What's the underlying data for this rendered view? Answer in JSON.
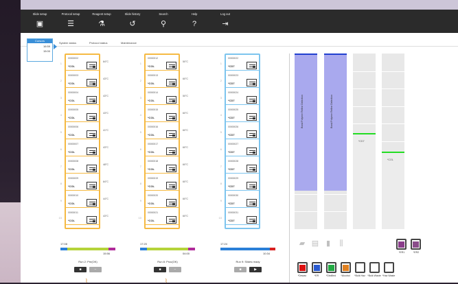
{
  "menu": [
    {
      "label": "Slide setup",
      "icon": "slide-setup-icon",
      "glyph": "▣"
    },
    {
      "label": "Protocol setup",
      "icon": "protocol-setup-icon",
      "glyph": "☰"
    },
    {
      "label": "Reagent setup",
      "icon": "reagent-setup-icon",
      "glyph": "⚗"
    },
    {
      "label": "Slide history",
      "icon": "slide-history-icon",
      "glyph": "↺"
    },
    {
      "label": "Search",
      "icon": "search-icon",
      "glyph": "⚲"
    },
    {
      "label": "Help",
      "icon": "help-icon",
      "glyph": "?"
    },
    {
      "label": "Log out",
      "icon": "logout-icon",
      "glyph": "⇥"
    }
  ],
  "tabs": [
    "System status",
    "Protocol status",
    "Maintenance"
  ],
  "timebox": {
    "header": "Cursors",
    "times": [
      "16:59",
      "15:00"
    ]
  },
  "baths": [
    {
      "color": "#f5b942",
      "slots": [
        {
          "n": "1",
          "code": "00000002",
          "sub": "*COL",
          "temp": "84°C"
        },
        {
          "n": "2",
          "code": "00000003",
          "sub": "*COL",
          "temp": "43°C"
        },
        {
          "n": "3",
          "code": "00000004",
          "sub": "*COL",
          "temp": "43°C"
        },
        {
          "n": "4",
          "code": "00000005",
          "sub": "*COL",
          "temp": "43°C"
        },
        {
          "n": "5",
          "code": "00000006",
          "sub": "*COL",
          "temp": "41°C"
        },
        {
          "n": "6",
          "code": "00000007",
          "sub": "*COL",
          "temp": "43°C"
        },
        {
          "n": "7",
          "code": "00000008",
          "sub": "*COL",
          "temp": "48°C"
        },
        {
          "n": "8",
          "code": "00000009",
          "sub": "*COL",
          "temp": "84°C"
        },
        {
          "n": "9",
          "code": "00000010",
          "sub": "*COL",
          "temp": "44°C"
        },
        {
          "n": "10",
          "code": "00000011",
          "sub": "*COL",
          "temp": "43°C"
        }
      ],
      "run": {
        "start": "17:08",
        "end": "15:56",
        "label": "Run 2: Pre(OK)"
      }
    },
    {
      "color": "#f5b942",
      "slots": [
        {
          "n": "1",
          "code": "00000012",
          "sub": "*COL",
          "temp": "50°C"
        },
        {
          "n": "2",
          "code": "00000013",
          "sub": "*COL",
          "temp": "60°C"
        },
        {
          "n": "3",
          "code": "00000014",
          "sub": "*COL",
          "temp": "50°C"
        },
        {
          "n": "4",
          "code": "00000015",
          "sub": "*COL",
          "temp": "60°C"
        },
        {
          "n": "5",
          "code": "00000016",
          "sub": "*COL",
          "temp": "60°C"
        },
        {
          "n": "6",
          "code": "00000017",
          "sub": "*COL",
          "temp": "60°C"
        },
        {
          "n": "7",
          "code": "00000018",
          "sub": "*COL",
          "temp": "60°C"
        },
        {
          "n": "8",
          "code": "00000019",
          "sub": "*COL",
          "temp": "60°C"
        },
        {
          "n": "9",
          "code": "00000020",
          "sub": "*COL",
          "temp": "60°C"
        },
        {
          "n": "10",
          "code": "00000021",
          "sub": "*COL",
          "temp": "60°C"
        }
      ],
      "run": {
        "start": "17:20",
        "end": "04:00",
        "label": "Run 8: Proc(OK)"
      }
    },
    {
      "color": "#7cc4ee",
      "slots": [
        {
          "n": "1",
          "code": "00000022",
          "sub": "*CD7",
          "temp": ""
        },
        {
          "n": "2",
          "code": "00000023",
          "sub": "*CD7",
          "temp": ""
        },
        {
          "n": "3",
          "code": "00000024",
          "sub": "*CD7",
          "temp": ""
        },
        {
          "n": "4",
          "code": "00000025",
          "sub": "*CD7",
          "temp": ""
        },
        {
          "n": "5",
          "code": "00000026",
          "sub": "*CD7",
          "temp": ""
        },
        {
          "n": "6",
          "code": "00000027",
          "sub": "*CD7",
          "temp": ""
        },
        {
          "n": "7",
          "code": "00000028",
          "sub": "*CD7",
          "temp": ""
        },
        {
          "n": "8",
          "code": "00000029",
          "sub": "*CD7",
          "temp": ""
        },
        {
          "n": "9",
          "code": "00000030",
          "sub": "*CD7",
          "temp": ""
        },
        {
          "n": "10",
          "code": "00000031",
          "sub": "*CD7",
          "temp": ""
        }
      ],
      "run": {
        "start": "17:24",
        "end": "10:34",
        "label": "Run 9: Slides ready"
      }
    }
  ],
  "stations": [
    {
      "fill": "#a9a9ee",
      "top": "#1f3fcf",
      "vlabel": "Bond Polymer Refine Detection"
    },
    {
      "fill": "#a9a9ee",
      "top": "#1f3fcf",
      "vlabel": "Bond Polymer Refine Detection"
    },
    {
      "fill": "#e8e8e8",
      "top": "#e8e8e8",
      "green": "#22dd22",
      "flabel": "*CD7"
    },
    {
      "fill": "#e8e8e8",
      "top": "#e8e8e8",
      "green": "#22dd22",
      "flabel": "*COL"
    }
  ],
  "bulk": [
    {
      "label": "*Dewax",
      "color": "#dd1111"
    },
    {
      "label": "*ER",
      "color": "#2a5ad0"
    },
    {
      "label": "*Distilled",
      "color": "#22aa44"
    },
    {
      "label": "*Alcohol",
      "color": "#e08020"
    },
    {
      "label": "*Bulk Haz",
      "color": "#ffffff"
    },
    {
      "label": "*Bulk Waste",
      "color": "#ffffff"
    },
    {
      "label": "*Haz Waste",
      "color": "#ffffff"
    }
  ],
  "extra_bottles": [
    {
      "label": "*ER1",
      "color": "#8a3d8a"
    },
    {
      "label": "*ER2",
      "color": "#8a4d8a"
    }
  ],
  "status_icons": [
    "tray-icon",
    "printer-icon",
    "tube-icon",
    "rack-icon"
  ]
}
